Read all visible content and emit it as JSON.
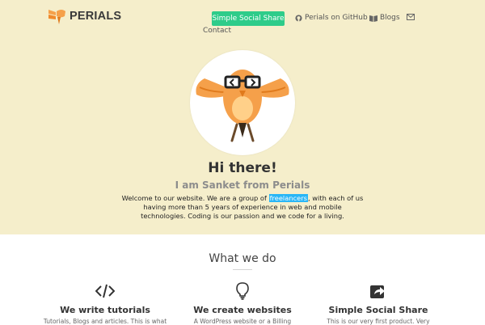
{
  "brand": {
    "name": "PERIALS"
  },
  "nav": {
    "primary_button": "Simple Social Share",
    "github_label": "Perials on GitHub",
    "blogs_label": "Blogs",
    "contact_label": "Contact"
  },
  "hero": {
    "headline": "Hi there!",
    "subheadline": "I am Sanket from Perials",
    "intro_before": "Welcome to our website. We are a group of ",
    "intro_highlight": "freelancers",
    "intro_after": ", with each of us having more than 5 years of experience in web and mobile technologies. Coding is our passion and we code for a living."
  },
  "what_we_do": {
    "title": "What we do",
    "features": [
      {
        "icon": "code-icon",
        "title": "We write tutorials",
        "desc": "Tutorials, Blogs and articles. This is what"
      },
      {
        "icon": "lightbulb-icon",
        "title": "We create websites",
        "desc": "A WordPress website or a Billing"
      },
      {
        "icon": "share-icon",
        "title": "Simple Social Share",
        "desc": "This is our very first product. Very"
      }
    ]
  },
  "colors": {
    "hero_bg": "#f5eecb",
    "accent_green": "#2ecc8a",
    "highlight_blue": "#29b6f6",
    "bird_orange": "#f5a04a"
  }
}
